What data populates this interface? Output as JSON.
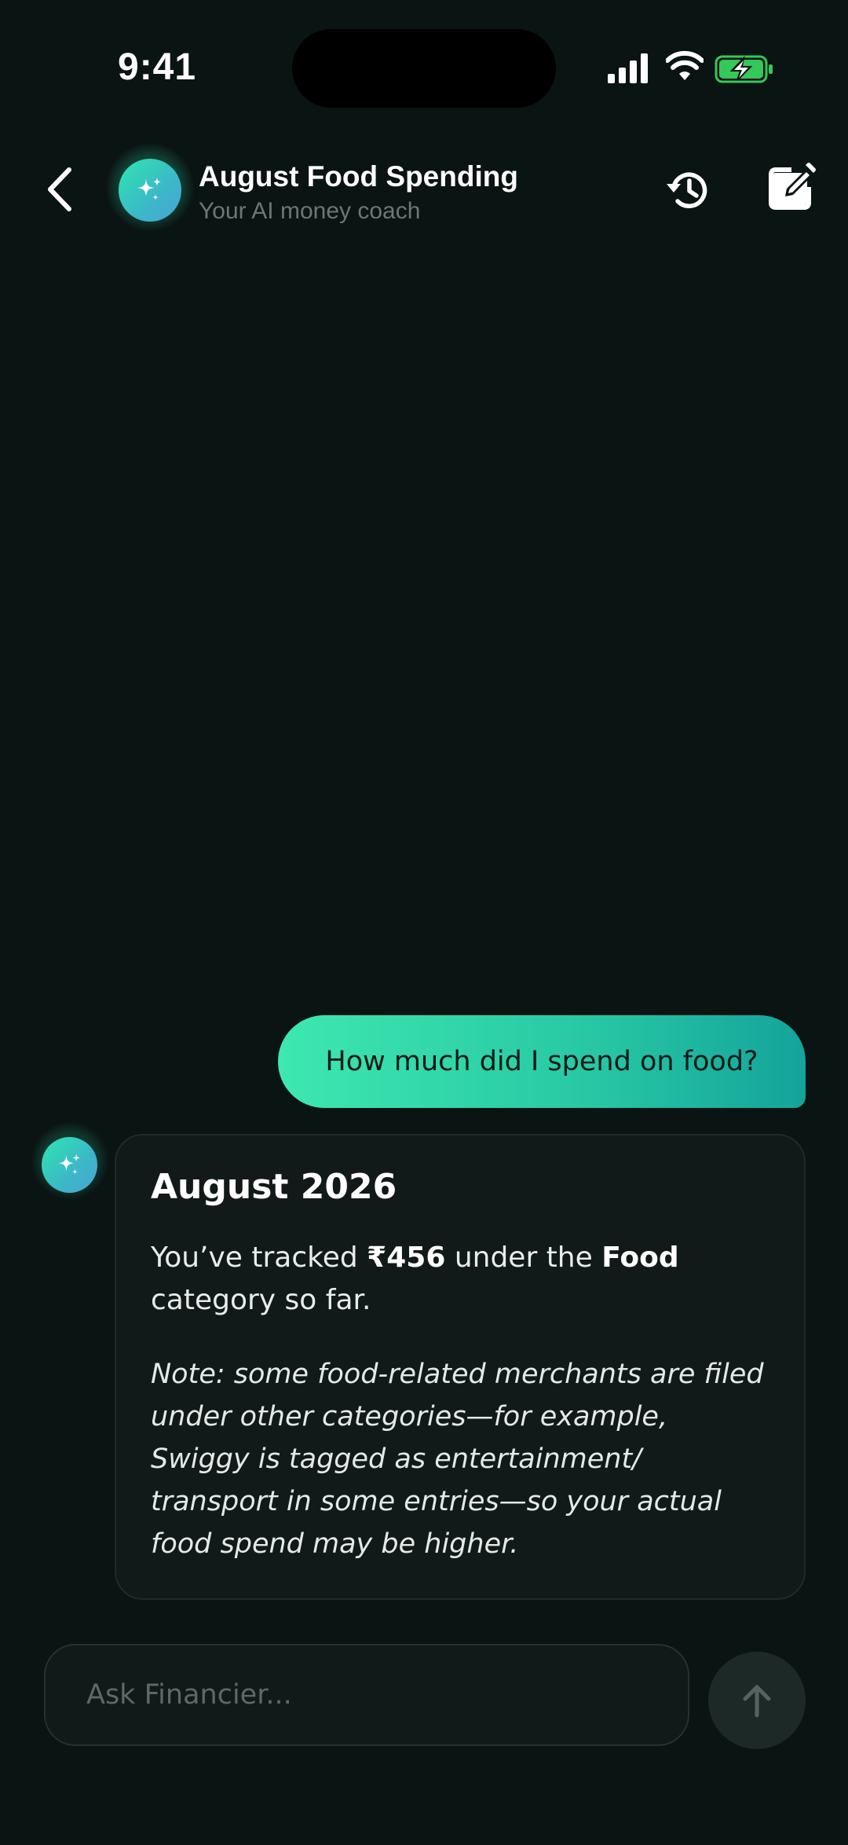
{
  "status_bar": {
    "time": "9:41",
    "battery_charging": true,
    "battery_color": "#34c759"
  },
  "header": {
    "title": "August Food Spending",
    "subtitle": "Your AI money coach",
    "back_icon": "chevron-left-icon",
    "avatar_icon": "sparkles-icon",
    "history_icon": "history-icon",
    "compose_icon": "compose-icon"
  },
  "conversation": {
    "user_message": "How much did I spend on food?",
    "assistant": {
      "title": "August 2026",
      "body_pre": "You’ve tracked ",
      "amount": "₹456",
      "body_mid": " under the ",
      "category": "Food",
      "body_post": " category so far.",
      "note": "Note: some food-related merchants are filed under other categories—for example, Swiggy is tagged as entertainment/ transport in some entries—so your actual food spend may be higher."
    }
  },
  "composer": {
    "placeholder": "Ask Financier...",
    "value": "",
    "send_icon": "arrow-up-icon"
  },
  "colors": {
    "background": "#0a1412",
    "accent_start": "#3ee8b0",
    "accent_end": "#14a39b",
    "card": "#111a18"
  }
}
